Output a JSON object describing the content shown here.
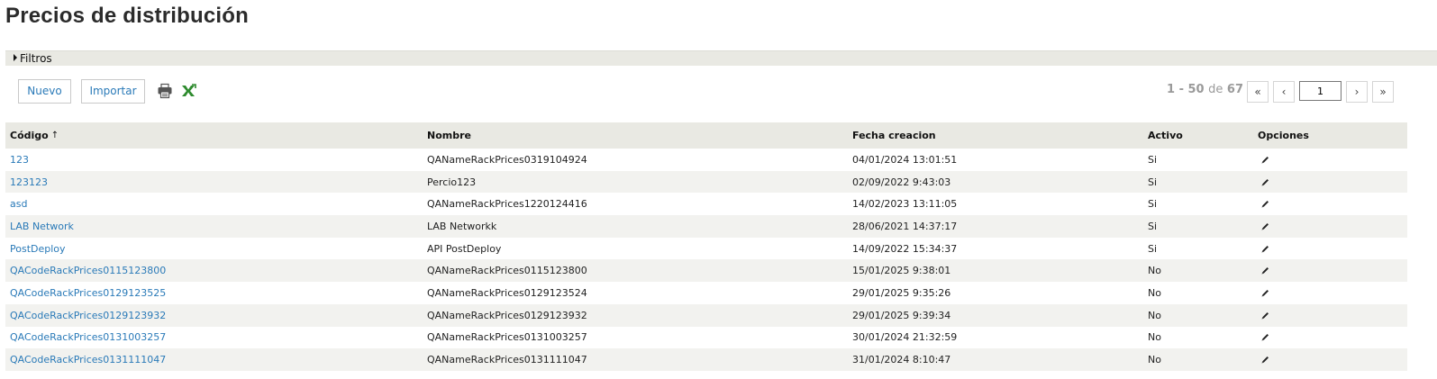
{
  "page": {
    "title": "Precios de distribución"
  },
  "filters": {
    "label": "Filtros"
  },
  "toolbar": {
    "new_label": "Nuevo",
    "import_label": "Importar",
    "print_icon": "print-icon",
    "excel_icon": "excel-export-icon"
  },
  "pager": {
    "range": "1 - 50",
    "of_label": "de",
    "total": "67",
    "first": "«",
    "prev": "‹",
    "page": "1",
    "next": "›",
    "last": "»"
  },
  "table": {
    "columns": {
      "code": "Código",
      "code_sort": "↑",
      "name": "Nombre",
      "created": "Fecha creacion",
      "active": "Activo",
      "options": "Opciones"
    },
    "rows": [
      {
        "code": "123",
        "name": "QANameRackPrices0319104924",
        "created": "04/01/2024 13:01:51",
        "active": "Si"
      },
      {
        "code": "123123",
        "name": "Percio123",
        "created": "02/09/2022 9:43:03",
        "active": "Si"
      },
      {
        "code": "asd",
        "name": "QANameRackPrices1220124416",
        "created": "14/02/2023 13:11:05",
        "active": "Si"
      },
      {
        "code": "LAB Network",
        "name": "LAB Networkk",
        "created": "28/06/2021 14:37:17",
        "active": "Si"
      },
      {
        "code": "PostDeploy",
        "name": "API PostDeploy",
        "created": "14/09/2022 15:34:37",
        "active": "Si"
      },
      {
        "code": "QACodeRackPrices0115123800",
        "name": "QANameRackPrices0115123800",
        "created": "15/01/2025 9:38:01",
        "active": "No"
      },
      {
        "code": "QACodeRackPrices0129123525",
        "name": "QANameRackPrices0129123524",
        "created": "29/01/2025 9:35:26",
        "active": "No"
      },
      {
        "code": "QACodeRackPrices0129123932",
        "name": "QANameRackPrices0129123932",
        "created": "29/01/2025 9:39:34",
        "active": "No"
      },
      {
        "code": "QACodeRackPrices0131003257",
        "name": "QANameRackPrices0131003257",
        "created": "30/01/2024 21:32:59",
        "active": "No"
      },
      {
        "code": "QACodeRackPrices0131111047",
        "name": "QANameRackPrices0131111047",
        "created": "31/01/2024 8:10:47",
        "active": "No"
      }
    ]
  },
  "colors": {
    "link": "#2a7ab8",
    "header_bg": "#e9e9e3",
    "alt_row": "#f2f2ef",
    "excel_green": "#2e8b2e"
  }
}
